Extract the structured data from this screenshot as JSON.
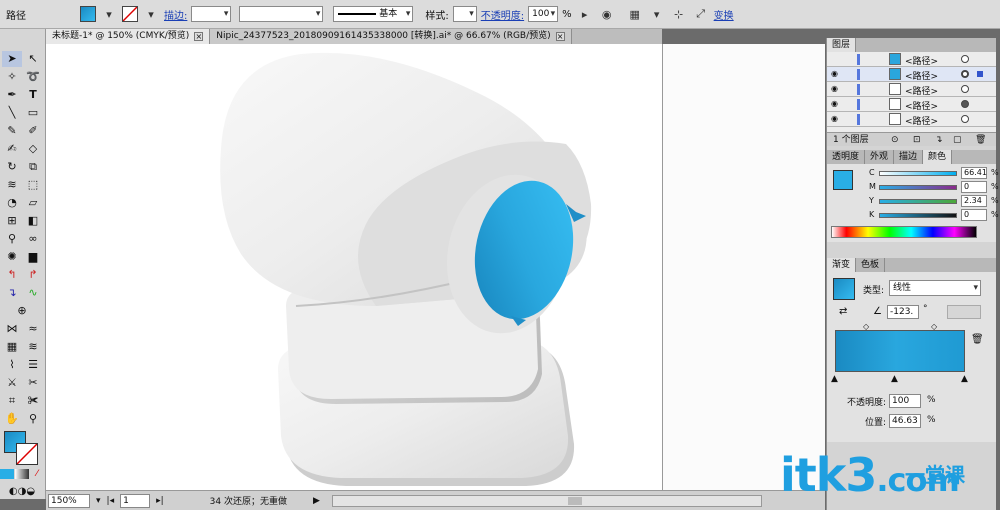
{
  "control_bar": {
    "object_type": "路径",
    "stroke_link": "描边:",
    "stroke_profile": "基本",
    "style_label": "样式:",
    "opacity_link": "不透明度:",
    "opacity_value": "100",
    "opacity_unit": "%",
    "transform_link": "变换"
  },
  "tabs": [
    {
      "label": "未标题-1* @ 150% (CMYK/预览)",
      "active": true
    },
    {
      "label": "Nipic_24377523_20180909161435338000 [转换].ai* @ 66.67% (RGB/预览)",
      "active": false
    }
  ],
  "status_bar": {
    "zoom": "150%",
    "page": "1",
    "message": "34 次还原；无重做"
  },
  "layers_panel": {
    "title": "图层",
    "rows": [
      {
        "name": "<路径>",
        "thumb": "blue"
      },
      {
        "name": "<路径>",
        "thumb": "blue"
      },
      {
        "name": "<路径>",
        "thumb": "white"
      },
      {
        "name": "<路径>",
        "thumb": "white"
      },
      {
        "name": "<路径>",
        "thumb": "white"
      }
    ],
    "footer": "1 个图层"
  },
  "color_panel": {
    "tabs": [
      "透明度",
      "外观",
      "描边",
      "颜色"
    ],
    "channels": [
      {
        "ch": "C",
        "value": "66.41"
      },
      {
        "ch": "M",
        "value": "0"
      },
      {
        "ch": "Y",
        "value": "2.34"
      },
      {
        "ch": "K",
        "value": "0"
      }
    ],
    "unit": "%",
    "fill_color": "#29aee6"
  },
  "gradient_panel": {
    "tabs": [
      "渐变",
      "色板"
    ],
    "type_label": "类型:",
    "type_value": "线性",
    "angle": "-123.",
    "angle_unit": "°",
    "opacity_label": "不透明度:",
    "opacity_value": "100",
    "position_label": "位置:",
    "position_value": "46.63",
    "unit": "%",
    "gradient_start": "#1a8ac2",
    "gradient_end": "#35bbf0"
  },
  "watermark": {
    "text": "itk3",
    "suffix": ".com",
    "cn": "一堂课"
  }
}
